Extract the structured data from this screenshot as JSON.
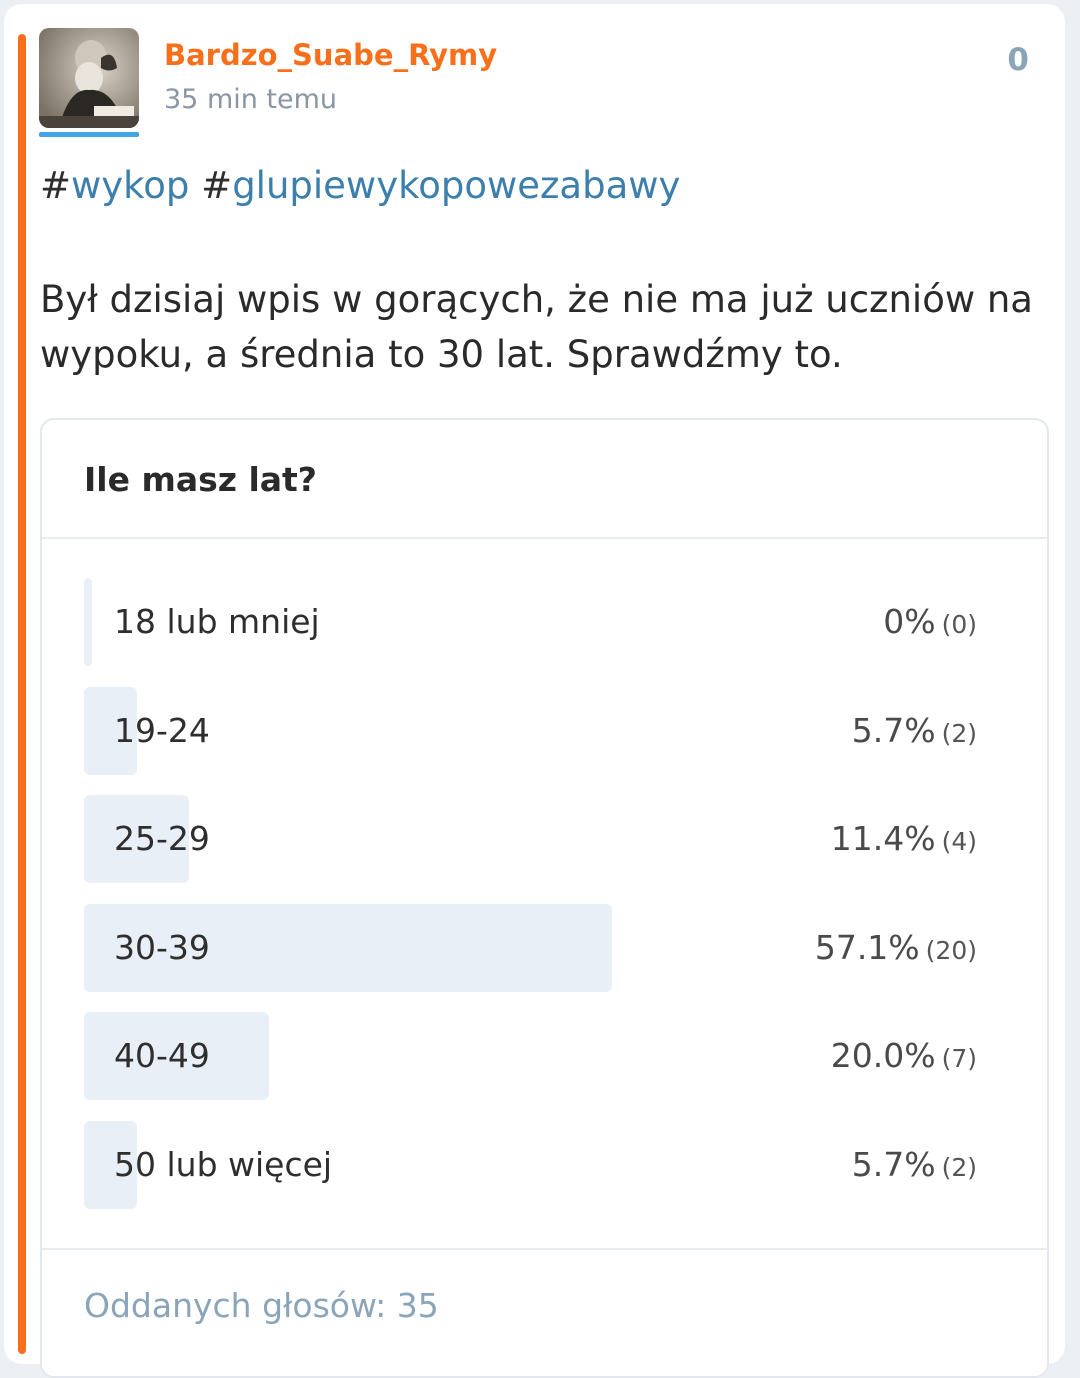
{
  "post": {
    "username": "Bardzo_Suabe_Rymy",
    "time_ago": "35 min temu",
    "votes": "0",
    "tags": [
      "#wykop",
      "#glupiewykopowezabawy"
    ],
    "body": "Był dzisiaj wpis w gorących, że nie ma już uczniów na wypoku, a średnia to 30 lat. Sprawdźmy to."
  },
  "poll": {
    "question": "Ile masz lat?",
    "options": [
      {
        "label": "18 lub mniej",
        "percent_text": "0%",
        "count_text": "(0)",
        "percent": 0
      },
      {
        "label": "19-24",
        "percent_text": "5.7%",
        "count_text": "(2)",
        "percent": 5.7
      },
      {
        "label": "25-29",
        "percent_text": "11.4%",
        "count_text": "(4)",
        "percent": 11.4
      },
      {
        "label": "30-39",
        "percent_text": "57.1%",
        "count_text": "(20)",
        "percent": 57.1
      },
      {
        "label": "40-49",
        "percent_text": "20.0%",
        "count_text": "(7)",
        "percent": 20.0
      },
      {
        "label": "50 lub więcej",
        "percent_text": "5.7%",
        "count_text": "(2)",
        "percent": 5.7
      }
    ],
    "total": "Oddanych głosów: 35"
  },
  "colors": {
    "accent": "#f86f1b",
    "tag": "#3c7fad",
    "bar": "#e9eff6",
    "muted": "#8aa4ba"
  },
  "icons": {
    "avatar": "avatar-image"
  }
}
